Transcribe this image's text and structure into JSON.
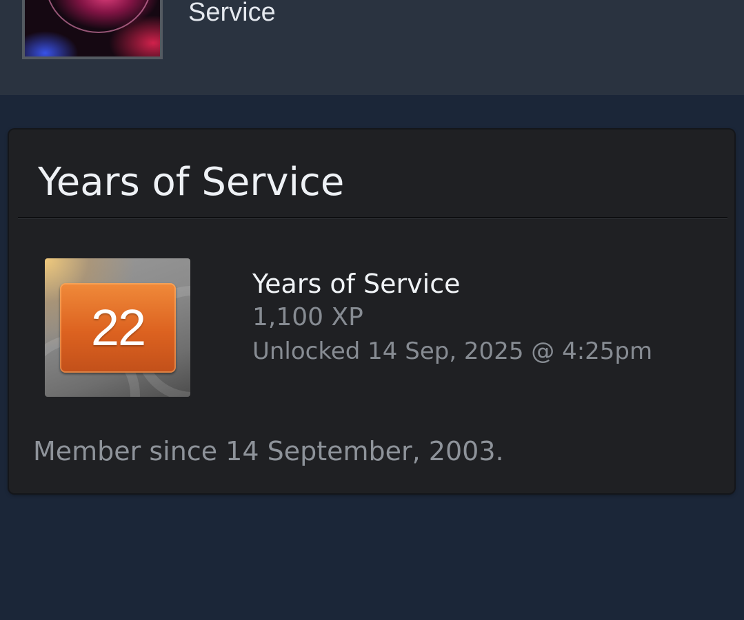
{
  "header": {
    "label": "Service"
  },
  "card": {
    "title": "Years of Service",
    "badge": {
      "number": "22",
      "name": "Years of Service",
      "xp": "1,100 XP",
      "unlocked": "Unlocked 14 Sep, 2025 @ 4:25pm"
    },
    "member_since": "Member since 14 September, 2003."
  }
}
